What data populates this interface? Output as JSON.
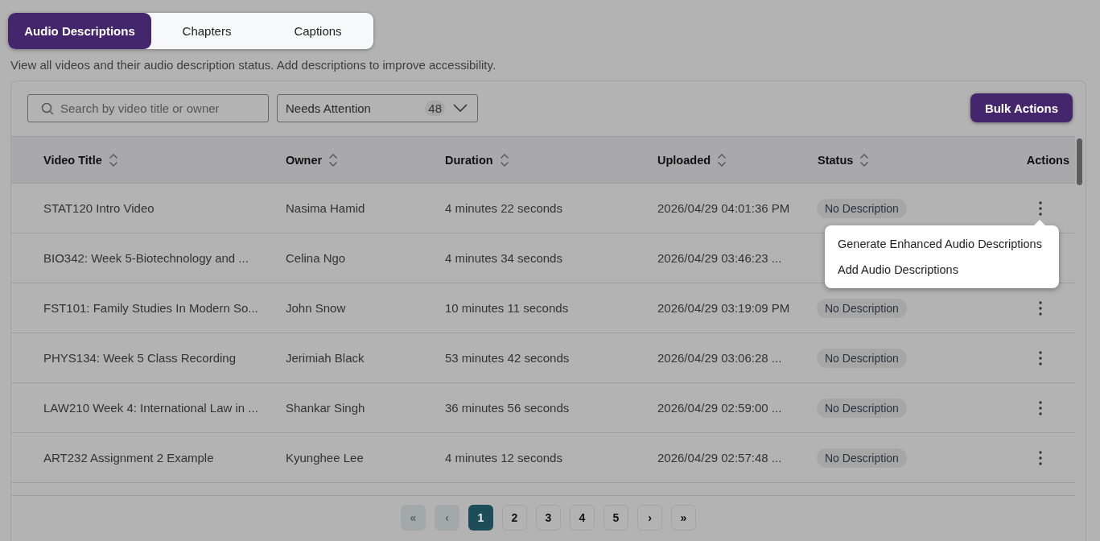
{
  "tabs": [
    {
      "label": "Audio Descriptions",
      "selected": true
    },
    {
      "label": "Chapters",
      "selected": false
    },
    {
      "label": "Captions",
      "selected": false
    }
  ],
  "description": "View all videos and their audio description status. Add descriptions to improve accessibility.",
  "search": {
    "placeholder": "Search by video title or owner"
  },
  "filter": {
    "value": "Needs Attention",
    "count": "48"
  },
  "bulk_button": "Bulk Actions",
  "table": {
    "columns": [
      {
        "label": "Video Title",
        "sortable": true
      },
      {
        "label": "Owner",
        "sortable": true
      },
      {
        "label": "Duration",
        "sortable": true
      },
      {
        "label": "Uploaded",
        "sortable": true
      },
      {
        "label": "Status",
        "sortable": true
      },
      {
        "label": "Actions",
        "sortable": false
      }
    ],
    "rows": [
      {
        "title": "STAT120 Intro Video",
        "owner": "Nasima Hamid",
        "duration": "4 minutes 22 seconds",
        "uploaded": "2026/04/29 04:01:36 PM",
        "status": "No Description",
        "menu_open": true
      },
      {
        "title": "BIO342: Week 5-Biotechnology and ...",
        "owner": "Celina Ngo",
        "duration": "4 minutes 34 seconds",
        "uploaded": "2026/04/29 03:46:23 ...",
        "menu_open": false
      },
      {
        "title": "FST101: Family Studies In Modern So...",
        "owner": "John Snow",
        "duration": "10 minutes 11 seconds",
        "uploaded": "2026/04/29 03:19:09 PM",
        "status": "No Description",
        "menu_open": false
      },
      {
        "title": "PHYS134: Week 5 Class Recording",
        "owner": "Jerimiah Black",
        "duration": "53 minutes 42 seconds",
        "uploaded": "2026/04/29 03:06:28 ...",
        "status": "No Description",
        "menu_open": false
      },
      {
        "title": "LAW210 Week 4: International Law in ...",
        "owner": "Shankar Singh",
        "duration": "36 minutes 56 seconds",
        "uploaded": "2026/04/29 02:59:00 ...",
        "status": "No Description",
        "menu_open": false
      },
      {
        "title": "ART232 Assignment 2 Example",
        "owner": "Kyunghee Lee",
        "duration": "4 minutes 12 seconds",
        "uploaded": "2026/04/29 02:57:48 ...",
        "status": "No Description",
        "menu_open": false
      }
    ]
  },
  "row_menu": {
    "items": [
      "Generate Enhanced Audio Descriptions",
      "Add Audio Descriptions"
    ]
  },
  "pagination": [
    {
      "label": "«",
      "selected": false,
      "disabled": true
    },
    {
      "label": "‹",
      "selected": false,
      "disabled": true
    },
    {
      "label": "1",
      "selected": true,
      "disabled": false
    },
    {
      "label": "2",
      "selected": false,
      "disabled": false
    },
    {
      "label": "3",
      "selected": false,
      "disabled": false
    },
    {
      "label": "4",
      "selected": false,
      "disabled": false
    },
    {
      "label": "5",
      "selected": false,
      "disabled": false
    },
    {
      "label": "›",
      "selected": false,
      "disabled": false
    },
    {
      "label": "»",
      "selected": false,
      "disabled": false
    }
  ]
}
